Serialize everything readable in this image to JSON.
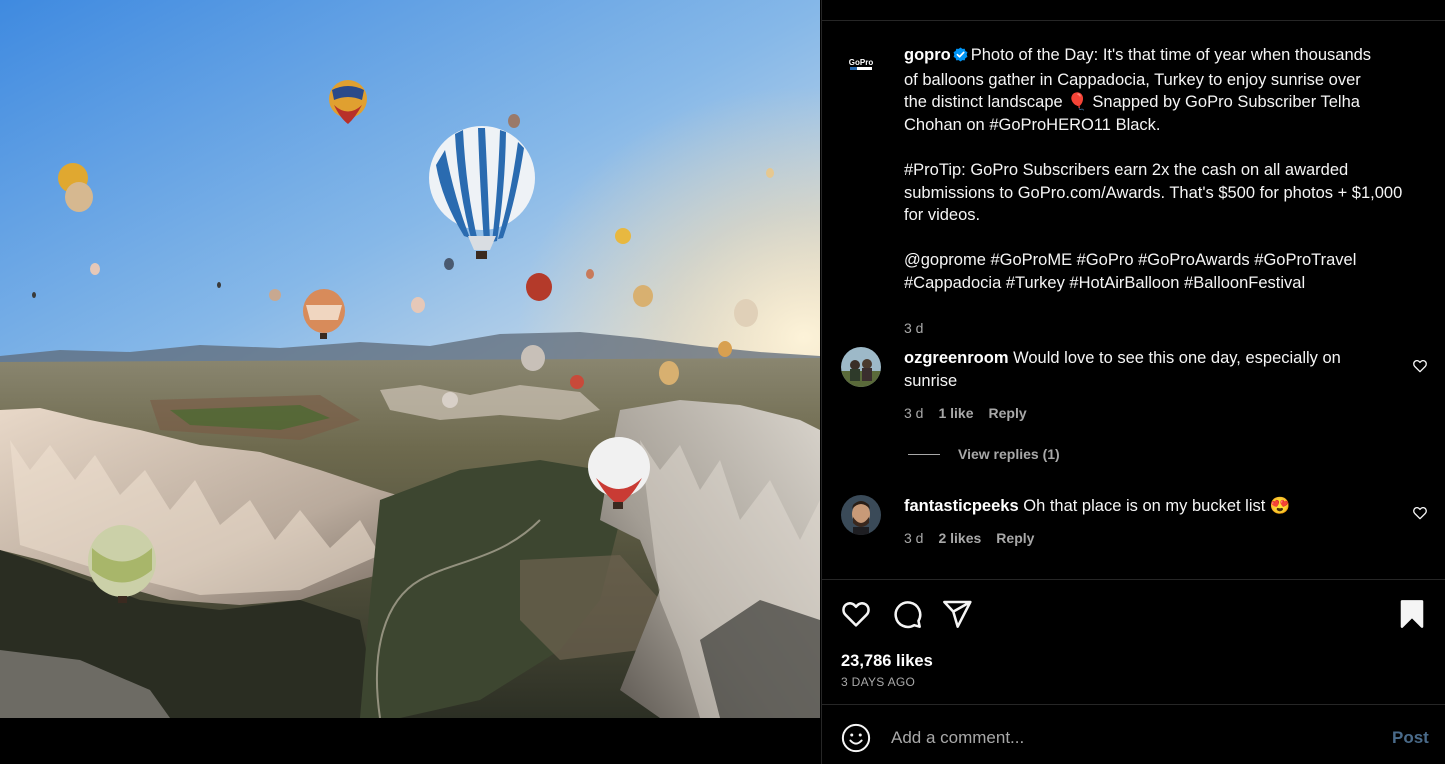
{
  "post": {
    "username": "gopro",
    "verified": true,
    "avatar_logo_text": "GoPro",
    "caption_lines": [
      "Photo of the Day: It's that time of year when thousands",
      "of balloons gather in Cappadocia, Turkey to enjoy sunrise over",
      "the distinct landscape 🎈 Snapped by GoPro Subscriber Telha",
      "Chohan on #GoProHERO11 Black."
    ],
    "caption_p2": "#ProTip: GoPro Subscribers earn 2x the cash on all awarded submissions to GoPro.com/Awards. That's $500 for photos + $1,000 for videos.",
    "caption_p3": "@goprome #GoProME #GoPro #GoProAwards #GoProTravel #Cappadocia #Turkey #HotAirBalloon #BalloonFestival",
    "time": "3 d",
    "likes": "23,786 likes",
    "date": "3 DAYS AGO"
  },
  "comments": [
    {
      "username": "ozgreenroom",
      "text": "Would love to see this one day, especially on sunrise",
      "time": "3 d",
      "likes": "1 like",
      "reply": "Reply"
    },
    {
      "username": "fantasticpeeks",
      "text": "Oh that place is on my bucket list 😍",
      "time": "3 d",
      "likes": "2 likes",
      "reply": "Reply"
    }
  ],
  "view_replies": "View replies (1)",
  "add_comment": {
    "placeholder": "Add a comment...",
    "post_label": "Post"
  },
  "icons": {
    "like": "heart-icon",
    "comment": "comment-icon",
    "share": "send-icon",
    "save": "bookmark-icon",
    "emoji": "emoji-icon",
    "verified": "verified-badge-icon"
  },
  "colors": {
    "background": "#000000",
    "text": "#f5f5f5",
    "secondary": "#a8a8a8",
    "verified": "#0095f6",
    "divider": "#262626",
    "post_disabled": "#4a6b8a"
  }
}
